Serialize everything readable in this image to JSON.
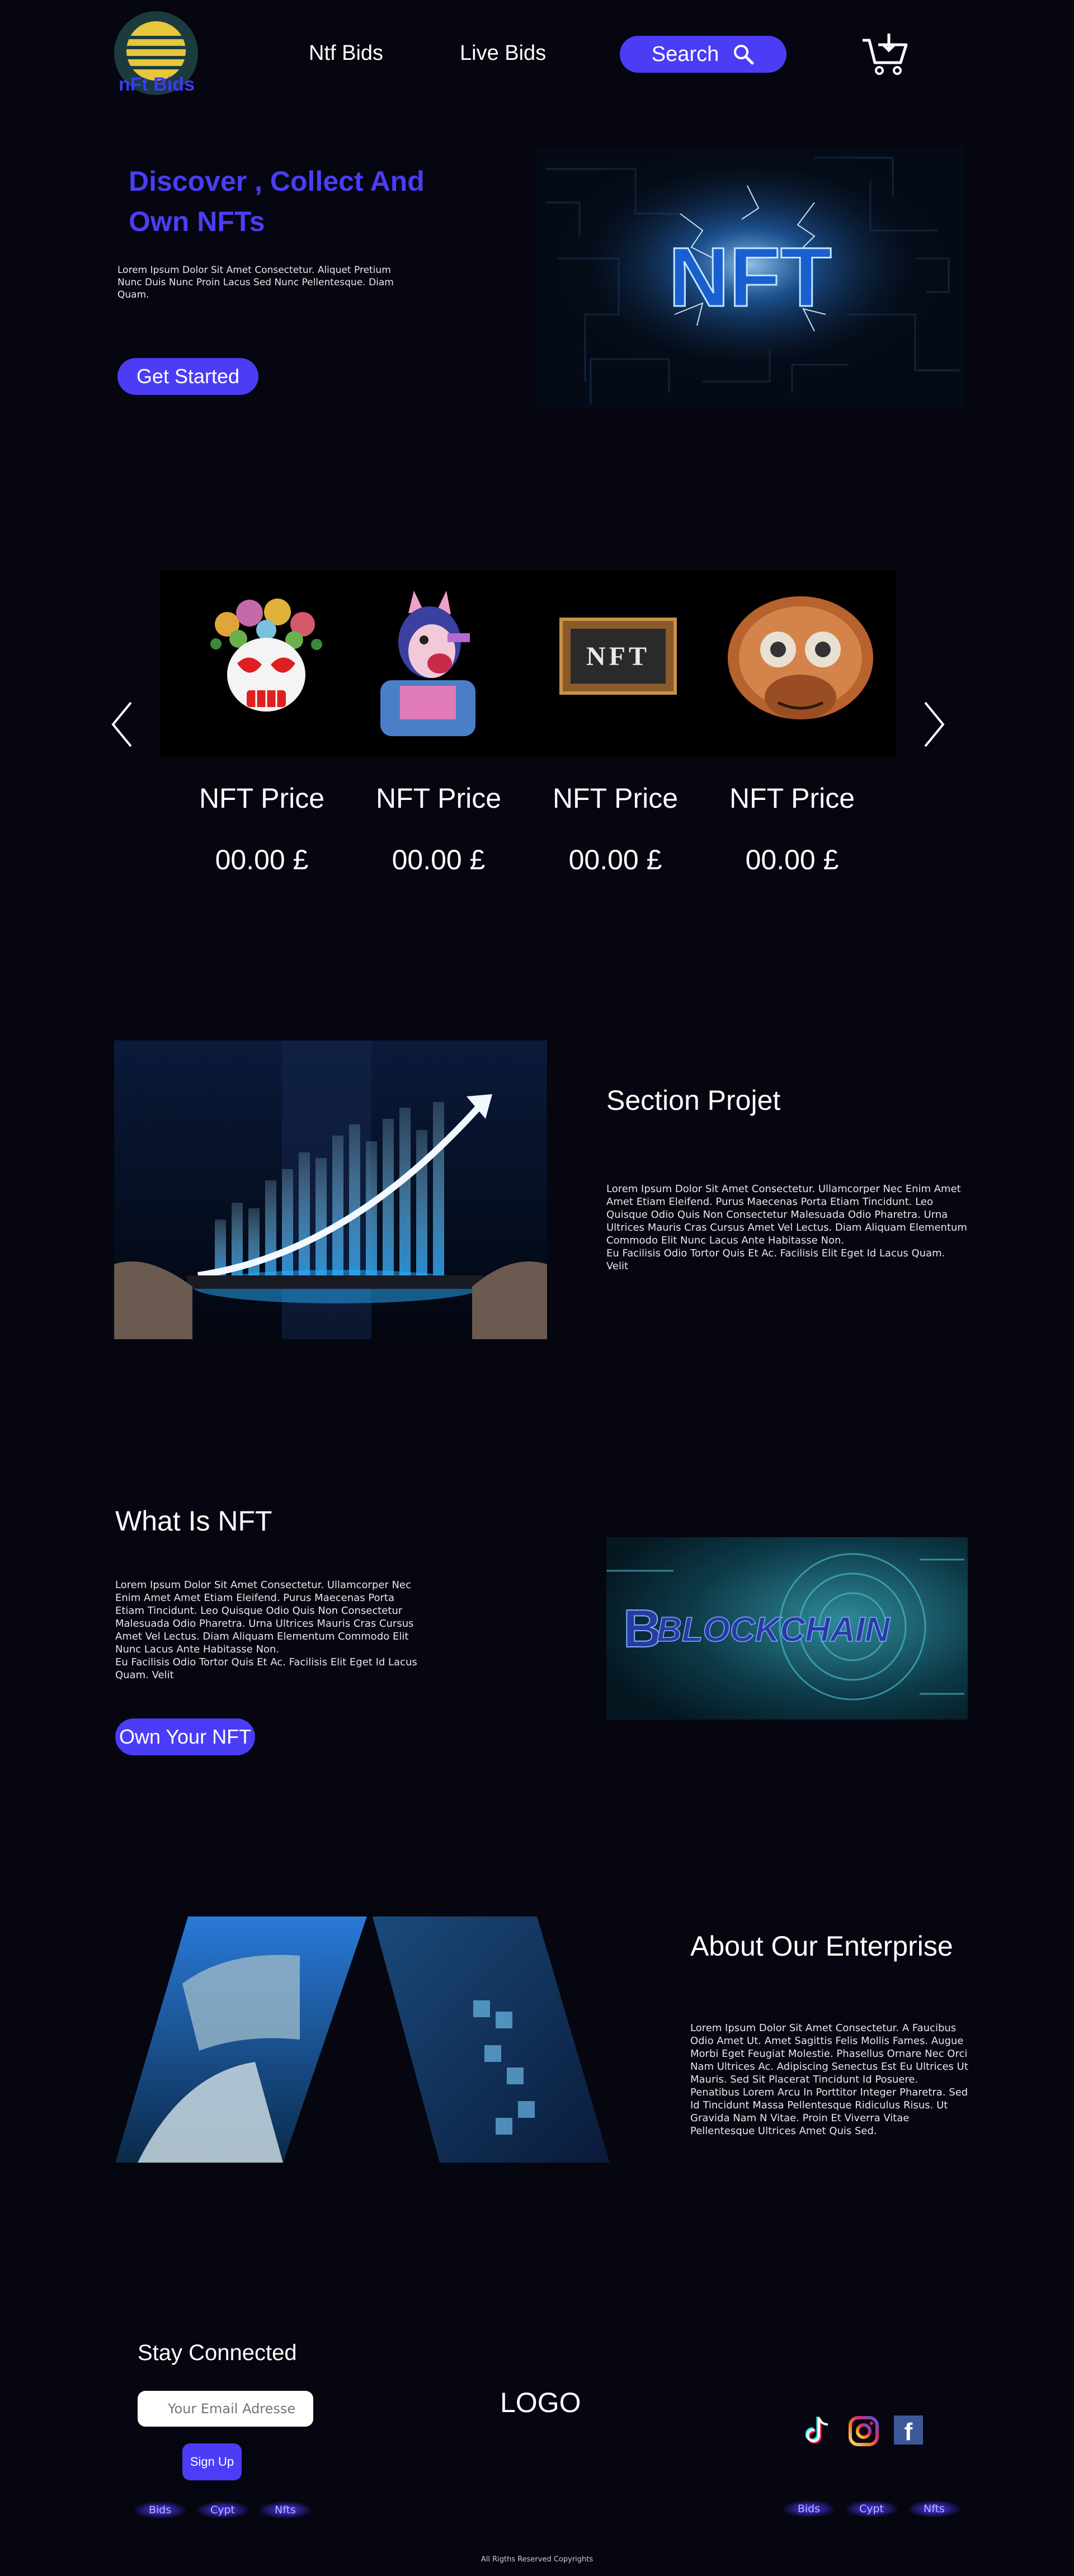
{
  "header": {
    "logo_text": "nFt Bids",
    "nav": [
      "Ntf Bids",
      "Live Bids"
    ],
    "search_label": "Search"
  },
  "hero": {
    "title_line1": "Discover , Collect  And",
    "title_line2": "Own NFTs",
    "description": "Lorem Ipsum Dolor Sit Amet Consectetur. Aliquet Pretium Nunc Duis Nunc Proin Lacus Sed Nunc Pellentesque. Diam Quam.",
    "cta_label": "Get Started",
    "image_text": "NFT"
  },
  "carousel": {
    "items": [
      {
        "name": "skull-flowers",
        "price_label": "NFT Price",
        "price": "00.00 £"
      },
      {
        "name": "robot-horse",
        "price_label": "NFT Price",
        "price": "00.00 £"
      },
      {
        "name": "nft-frame",
        "price_label": "NFT Price",
        "price": "00.00 £",
        "frame_text": "NFT"
      },
      {
        "name": "mech-monkey",
        "price_label": "NFT Price",
        "price": "00.00 £"
      }
    ]
  },
  "section_projet": {
    "title": "Section Projet",
    "body_1": "Lorem Ipsum Dolor Sit Amet Consectetur. Ullamcorper Nec Enim Amet Amet Etiam Eleifend. Purus Maecenas Porta Etiam Tincidunt. Leo Quisque Odio Quis Non Consectetur Malesuada Odio Pharetra. Urna Ultrices Mauris Cras Cursus Amet Vel Lectus. Diam Aliquam Elementum Commodo Elit Nunc Lacus Ante Habitasse Non.",
    "body_2": "Eu Facilisis Odio Tortor Quis Et Ac. Facilisis Elit Eget Id Lacus Quam. Velit"
  },
  "what_is_nft": {
    "title": "What Is NFT",
    "body_1": "Lorem Ipsum Dolor Sit Amet Consectetur. Ullamcorper Nec Enim Amet Amet Etiam Eleifend. Purus Maecenas Porta Etiam Tincidunt. Leo Quisque Odio Quis Non Consectetur Malesuada Odio Pharetra. Urna Ultrices Mauris Cras Cursus Amet Vel Lectus. Diam Aliquam Elementum Commodo Elit Nunc Lacus Ante Habitasse Non.",
    "body_2": "Eu Facilisis Odio Tortor Quis Et Ac. Facilisis Elit Eget Id Lacus Quam. Velit",
    "cta_label": "Own Your NFT",
    "image_text": "BLOCKCHAIN"
  },
  "about": {
    "title": "About Our Enterprise",
    "body": "Lorem Ipsum Dolor Sit Amet Consectetur. A Faucibus Odio Amet Ut. Amet Sagittis Felis Mollis Fames. Augue Morbi Eget Feugiat Molestie. Phasellus Ornare Nec Orci Nam Ultrices Ac. Adipiscing Senectus Est Eu Ultrices Ut Mauris. Sed Sit Placerat Tincidunt Id Posuere. Penatibus Lorem Arcu In Porttitor Integer Pharetra. Sed Id Tincidunt Massa Pellentesque Ridiculus Risus. Ut Gravida Nam N Vitae. Proin Et Viverra Vitae Pellentesque Ultrices Amet Quis Sed."
  },
  "footer": {
    "stay_connected": "Stay Connected",
    "email_placeholder": "Your Email Adresse",
    "signup_label": "Sign Up",
    "logo": "LOGO",
    "links": [
      "Bids",
      "Cypt",
      "Nfts"
    ],
    "copyright": "All Rigths Reserved Copyrights",
    "social": [
      "tiktok-icon",
      "instagram-icon",
      "facebook-icon"
    ]
  },
  "colors": {
    "background": "#05060f",
    "accent": "#4b3df5",
    "logo_yellow": "#e6c63a"
  }
}
